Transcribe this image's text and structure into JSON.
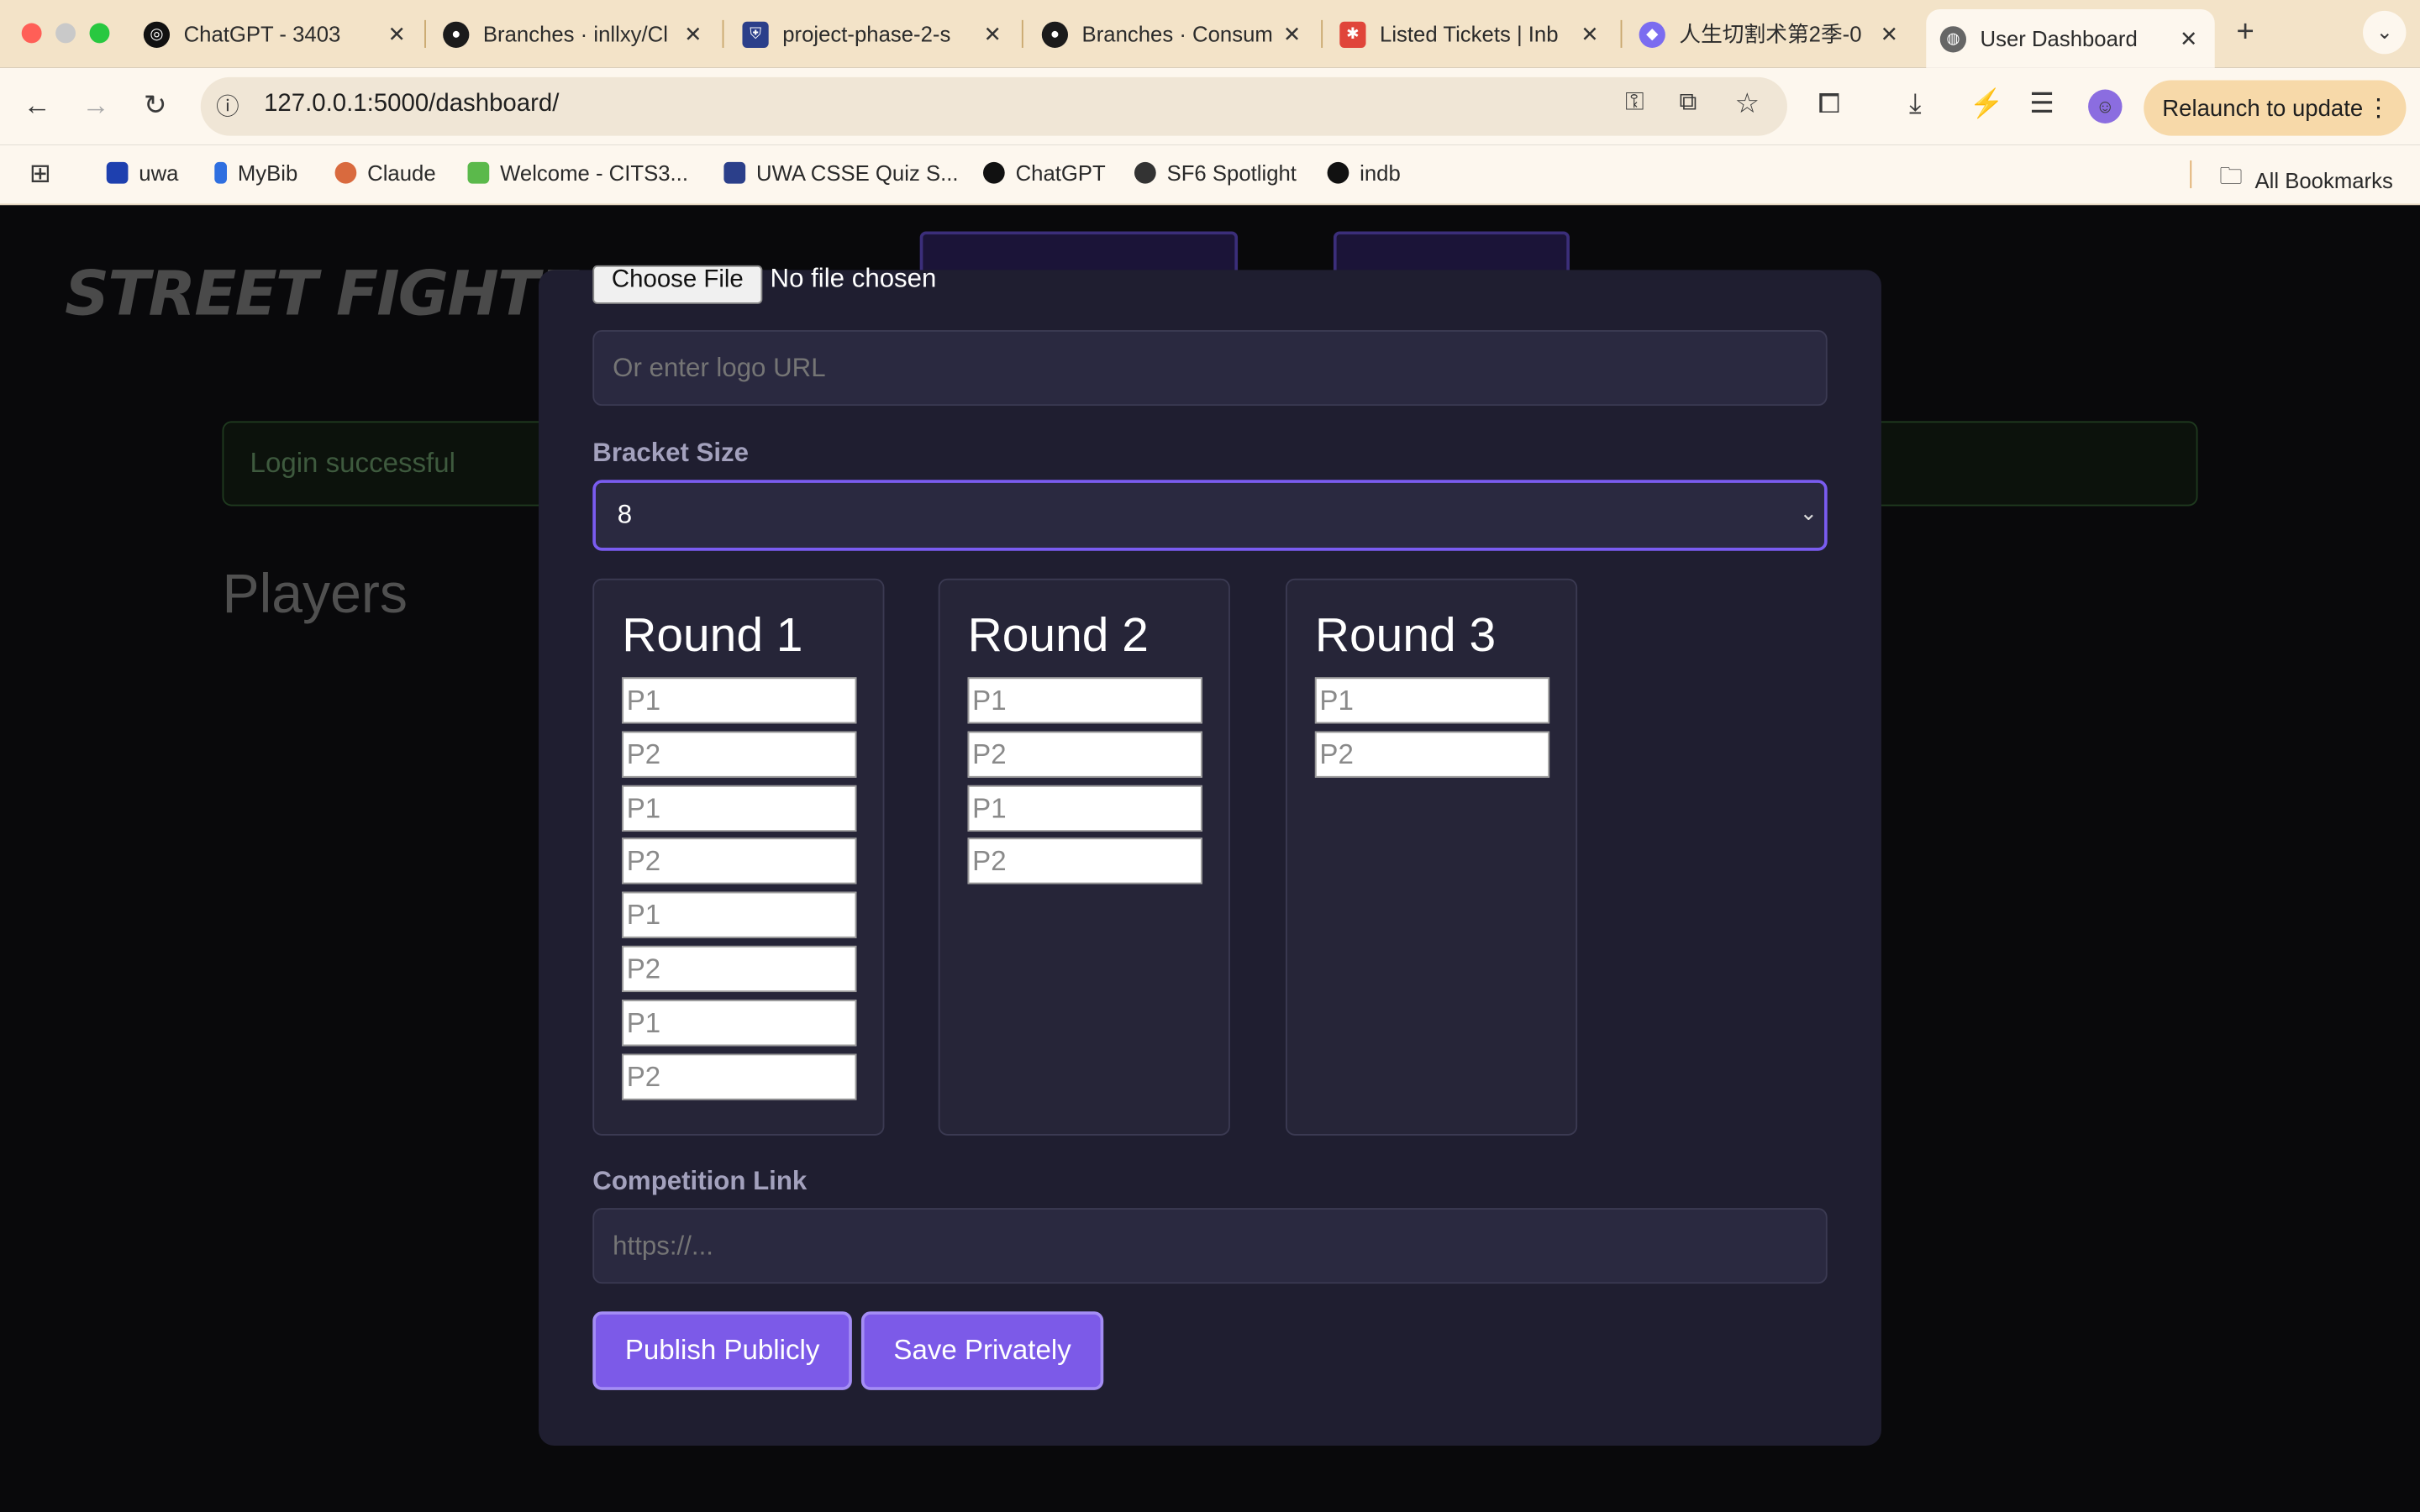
{
  "browser": {
    "tabs": [
      {
        "label": "ChatGPT - 3403",
        "icon": "chatgpt-icon"
      },
      {
        "label": "Branches · inllxy/Cl",
        "icon": "github-icon"
      },
      {
        "label": "project-phase-2-s",
        "icon": "uwa-icon"
      },
      {
        "label": "Branches · Consum",
        "icon": "github-icon"
      },
      {
        "label": "Listed Tickets | Inb",
        "icon": "ticket-icon"
      },
      {
        "label": "人生切割术第2季-0",
        "icon": "video-icon"
      },
      {
        "label": "User Dashboard",
        "icon": "globe-icon"
      }
    ],
    "url": "127.0.0.1:5000/dashboard/",
    "relaunch_label": "Relaunch to update",
    "bookmarks": [
      "uwa",
      "MyBib",
      "Claude",
      "Welcome - CITS3...",
      "UWA CSSE Quiz S...",
      "ChatGPT",
      "SF6 Spotlight",
      "indb"
    ],
    "all_bookmarks": "All Bookmarks"
  },
  "page": {
    "logo": "STREET FIGHTER",
    "alert": "Login successful",
    "players_heading": "Players"
  },
  "modal": {
    "file_button": "Choose File",
    "file_status": "No file chosen",
    "logo_url_placeholder": "Or enter logo URL",
    "bracket_label": "Bracket Size",
    "bracket_value": "8",
    "rounds": [
      {
        "title": "Round 1",
        "slots": [
          "P1",
          "P2",
          "P1",
          "P2",
          "P1",
          "P2",
          "P1",
          "P2"
        ]
      },
      {
        "title": "Round 2",
        "slots": [
          "P1",
          "P2",
          "P1",
          "P2"
        ]
      },
      {
        "title": "Round 3",
        "slots": [
          "P1",
          "P2"
        ]
      }
    ],
    "link_label": "Competition Link",
    "link_placeholder": "https://...",
    "publish_label": "Publish Publicly",
    "save_label": "Save Privately"
  },
  "colors": {
    "accent": "#7c5ae8",
    "modal_bg": "#1f1e30",
    "tabbar": "#f3e3c8"
  }
}
